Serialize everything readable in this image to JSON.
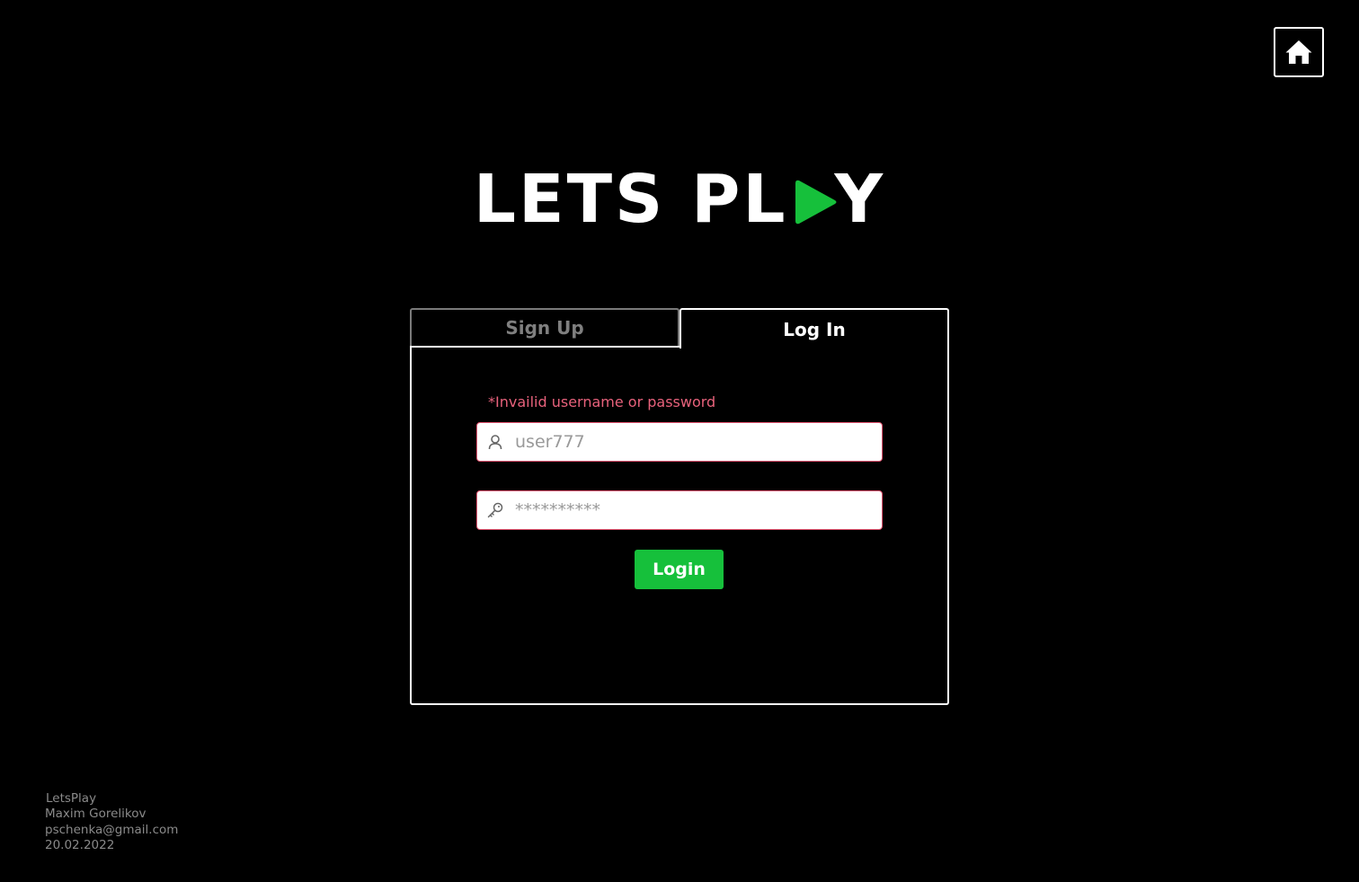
{
  "header": {
    "home_icon": "home-icon"
  },
  "logo": {
    "text_before": "LETS PL",
    "play_icon": "play-triangle-icon",
    "text_after": "Y",
    "accent_color": "#16c03b"
  },
  "tabs": [
    {
      "label": "Sign Up",
      "active": false
    },
    {
      "label": "Log In",
      "active": true
    }
  ],
  "form": {
    "error": "*Invailid username or password",
    "username": {
      "icon": "user-icon",
      "value": "user777",
      "placeholder": "user777"
    },
    "password": {
      "icon": "key-icon",
      "value": "**********",
      "placeholder": "**********"
    },
    "submit_label": "Login"
  },
  "footer": {
    "app": "LetsPlay",
    "author": "Maxim Gorelikov",
    "email": "pschenka@gmail.com",
    "date": "20.02.2022"
  },
  "colors": {
    "background": "#000000",
    "accent": "#16c03b",
    "error": "#e8627c"
  }
}
